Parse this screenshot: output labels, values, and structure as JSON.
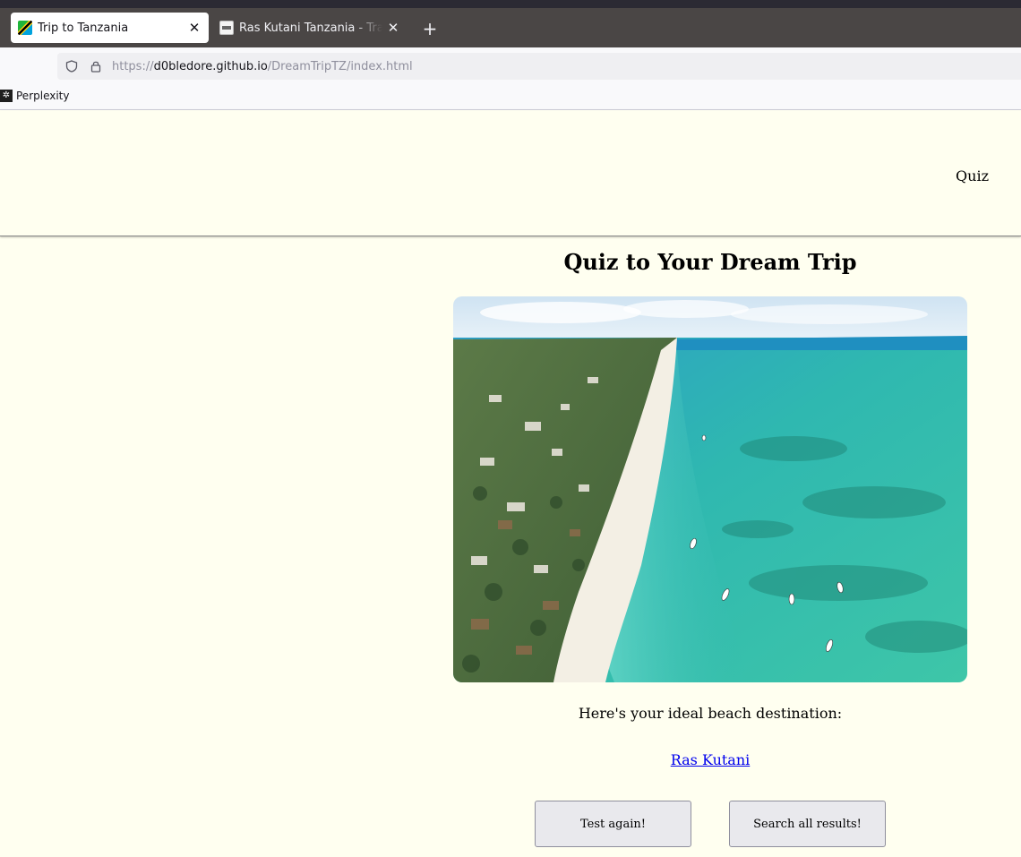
{
  "browser": {
    "tabs": [
      {
        "title": "Trip to Tanzania",
        "active": true,
        "favicon": "tanzania-flag-icon"
      },
      {
        "title": "Ras Kutani Tanzania - Travel",
        "active": false,
        "favicon": "site-favicon-icon"
      }
    ],
    "url": {
      "scheme": "https://",
      "host": "d0bledore.github.io",
      "path": "/DreamTripTZ/index.html"
    },
    "bookmarks": [
      {
        "label": "Perplexity",
        "icon": "perplexity-icon"
      }
    ]
  },
  "site": {
    "nav": {
      "quiz_label": "Quiz"
    },
    "title": "Quiz to Your Dream Trip",
    "image": {
      "description_icon": "beach-photo"
    },
    "result_label": "Here's your ideal beach destination:",
    "result_link": "Ras Kutani",
    "buttons": {
      "test_again": "Test again!",
      "search_all": "Search all results!"
    }
  },
  "colors": {
    "page_background": "#fffff0",
    "link": "#0000ee",
    "button_bg": "#e9e9ed"
  }
}
